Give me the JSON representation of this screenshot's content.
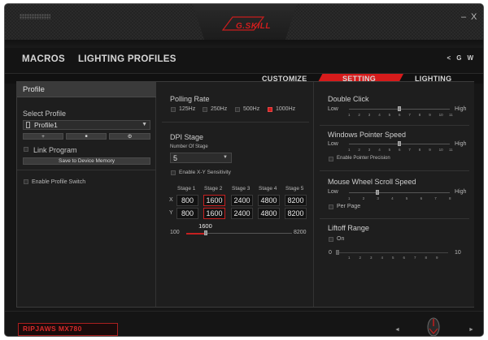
{
  "window": {
    "brand_logo": "G.SKILL",
    "minimize": "–",
    "close": "X"
  },
  "nav": {
    "macros": "MACROS",
    "lighting_profiles": "LIGHTING PROFILES",
    "tool_icons": [
      "share-icon",
      "G",
      "W"
    ]
  },
  "subtabs": {
    "customize": "CUSTOMIZE",
    "setting": "SETTING",
    "lighting": "LIGHTING",
    "active": "setting",
    "accent_color": "#d61b1b"
  },
  "profile": {
    "header": "Profile",
    "select_label": "Select Profile",
    "selected": "Profile1",
    "buttons": [
      "+",
      "■",
      "⚙"
    ],
    "link_program": "Link Program",
    "save_button": "Save to Device Memory",
    "enable_switch": "Enable Profile Switch"
  },
  "polling": {
    "title": "Polling Rate",
    "options": [
      "125Hz",
      "250Hz",
      "500Hz",
      "1000Hz"
    ],
    "selected": "1000Hz"
  },
  "dpi": {
    "title": "DPI Stage",
    "number_label": "Number Of Stage",
    "number_value": "5",
    "xy_label": "Enable X-Y Sensitivity",
    "stage_headers": [
      "Stage 1",
      "Stage 2",
      "Stage 3",
      "Stage 4",
      "Stage 5"
    ],
    "row_x_label": "X",
    "row_y_label": "Y",
    "x_values": [
      "800",
      "1600",
      "2400",
      "4800",
      "8200"
    ],
    "y_values": [
      "800",
      "1600",
      "2400",
      "4800",
      "8200"
    ],
    "selected_stage": 2,
    "slider_min": "100",
    "slider_max": "8200",
    "slider_value": "1600"
  },
  "double_click": {
    "title": "Double Click",
    "low": "Low",
    "high": "High",
    "ticks": [
      "1",
      "2",
      "3",
      "4",
      "5",
      "6",
      "7",
      "8",
      "9",
      "10",
      "11"
    ],
    "value": 6
  },
  "pointer_speed": {
    "title": "Windows Pointer Speed",
    "low": "Low",
    "high": "High",
    "ticks": [
      "1",
      "2",
      "3",
      "4",
      "5",
      "6",
      "7",
      "8",
      "9",
      "10",
      "11"
    ],
    "value": 6,
    "precision_label": "Enable Pointer Precision"
  },
  "scroll_speed": {
    "title": "Mouse Wheel Scroll Speed",
    "low": "Low",
    "high": "High",
    "ticks": [
      "1",
      "2",
      "3",
      "4",
      "5",
      "6",
      "7",
      "8"
    ],
    "value": 3,
    "per_page_label": "Per Page"
  },
  "liftoff": {
    "title": "Liftoff Range",
    "on_label": "On",
    "min_label": "0",
    "max_label": "10",
    "ticks": [
      "1",
      "2",
      "3",
      "4",
      "5",
      "6",
      "7",
      "8",
      "9"
    ],
    "value": 0
  },
  "footer": {
    "model": "RIPJAWS MX780",
    "prev": "◄",
    "next": "►"
  }
}
